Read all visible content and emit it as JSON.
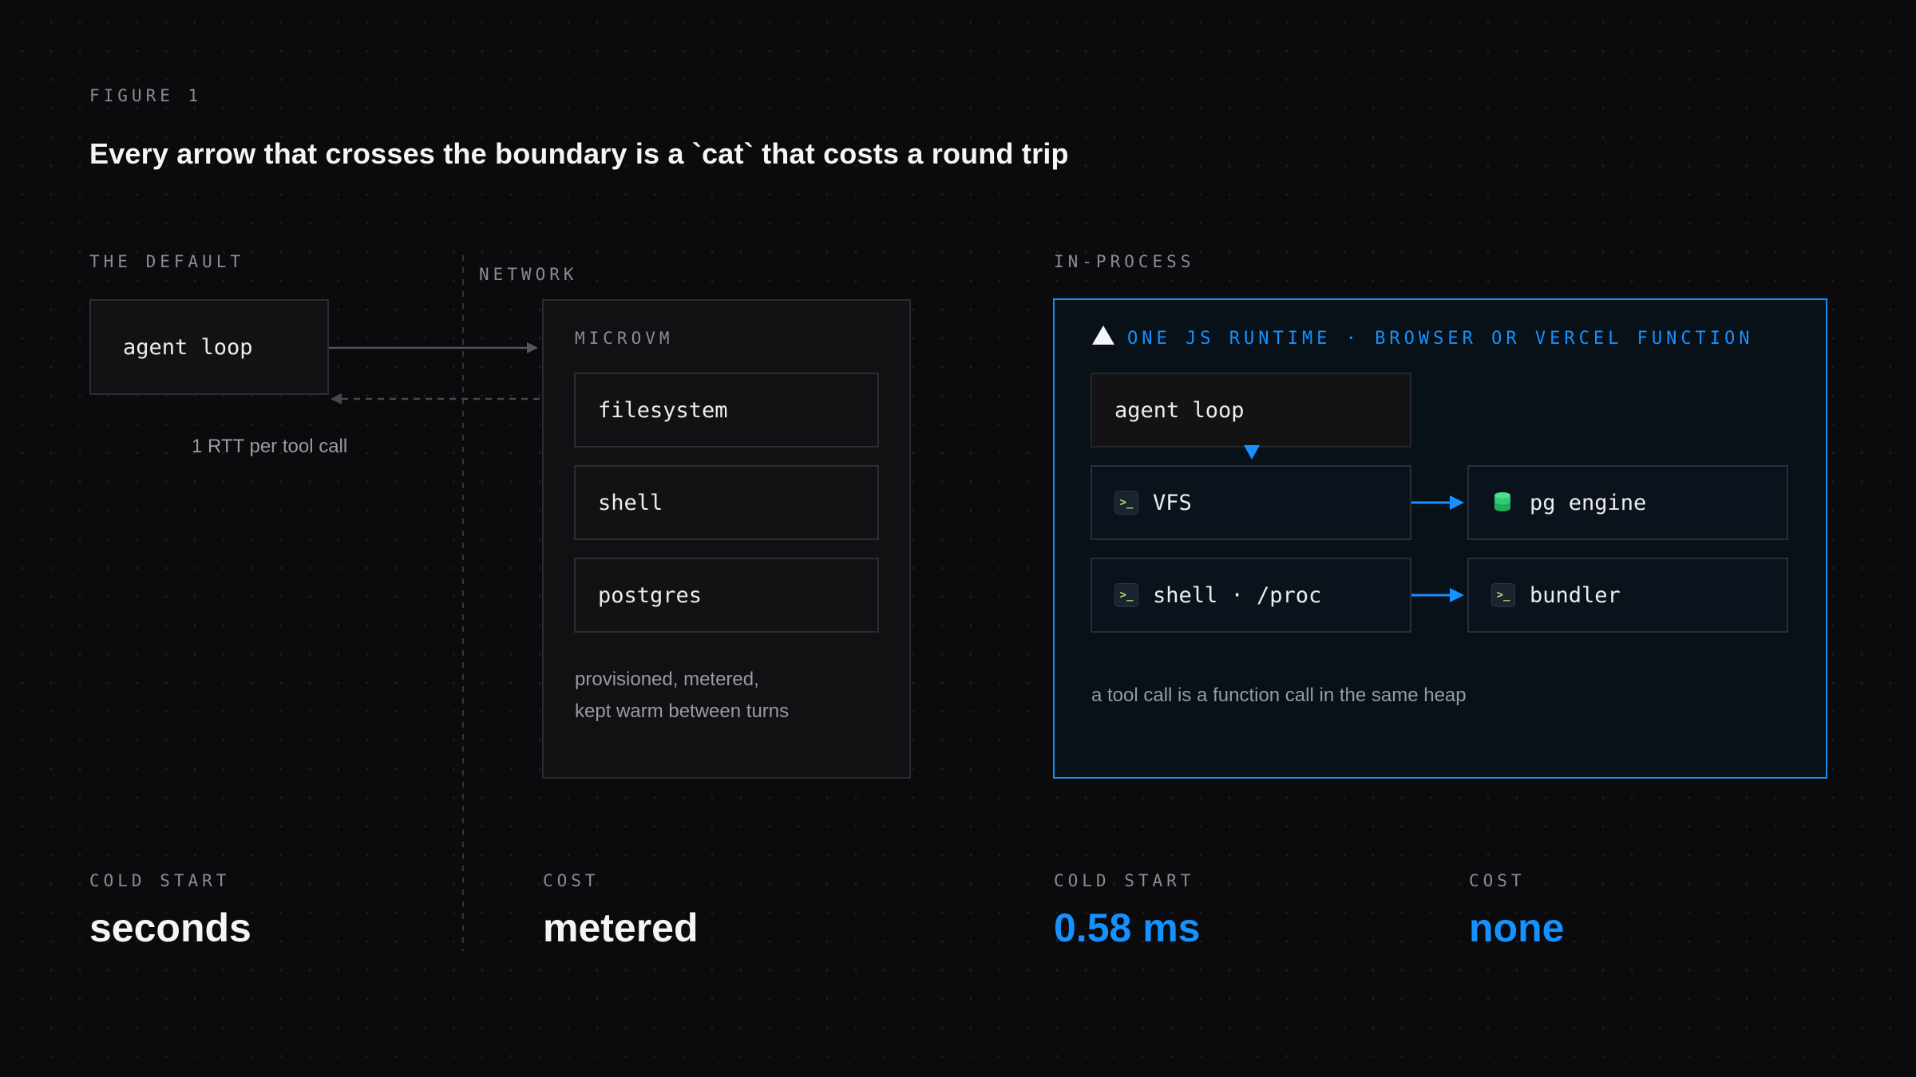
{
  "figure_label": "FIGURE 1",
  "title": "Every arrow that crosses the boundary is a `cat` that costs a round trip",
  "left": {
    "section_label": "THE DEFAULT",
    "agent_loop": "agent loop",
    "rtt_note": "1 RTT per tool call",
    "network_label": "NETWORK",
    "microvm_label": "MICROVM",
    "services": [
      "filesystem",
      "shell",
      "postgres"
    ],
    "note_line1": "provisioned, metered,",
    "note_line2": "kept warm between turns"
  },
  "right": {
    "section_label": "IN-PROCESS",
    "runtime_label": "ONE JS RUNTIME · BROWSER OR VERCEL FUNCTION",
    "agent_loop": "agent loop",
    "vfs": "VFS",
    "pg_engine": "pg engine",
    "shell_proc": "shell · /proc",
    "bundler": "bundler",
    "note": "a tool call is a function call in the same heap",
    "terminal_glyph": ">_"
  },
  "stats": [
    {
      "label": "COLD START",
      "value": "seconds"
    },
    {
      "label": "COST",
      "value": "metered"
    },
    {
      "label": "COLD START",
      "value": "0.58 ms"
    },
    {
      "label": "COST",
      "value": "none"
    }
  ],
  "colors": {
    "background": "#0b0b0d",
    "accent": "#1592ff",
    "terminal_prompt": "#a8e06a",
    "database": "#2ecc71"
  },
  "icons": {
    "runtime": "triangle-logo-icon",
    "terminal": "terminal-icon",
    "database": "database-icon"
  }
}
